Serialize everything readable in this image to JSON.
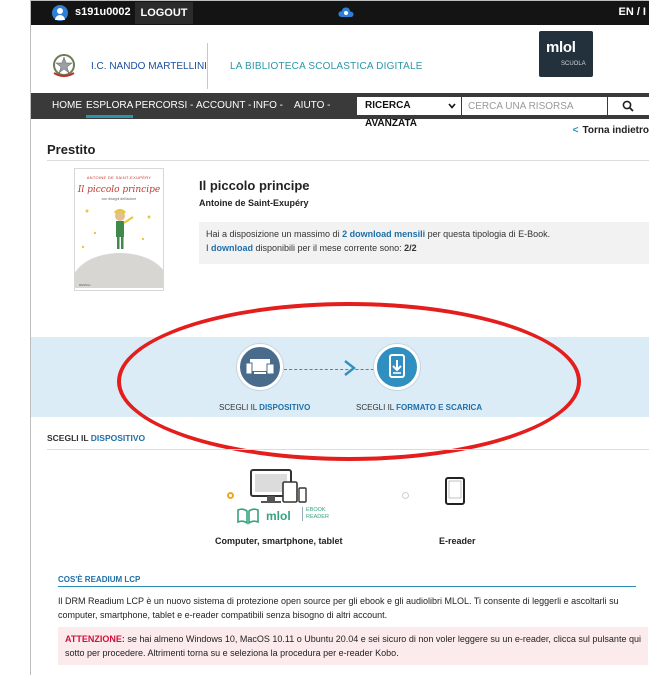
{
  "topbar": {
    "username": "s191u0002",
    "logout_label": "LOGOUT",
    "lang_label": "EN / I"
  },
  "header": {
    "school_name": "I.C. NANDO MARTELLINI",
    "library_title": "LA BIBLIOTECA SCOLASTICA DIGITALE",
    "mlol_logo_text": "mlol",
    "mlol_logo_sub": "SCUOLA"
  },
  "nav": {
    "items": [
      "HOME",
      "ESPLORA",
      "PERCORSI -",
      "ACCOUNT -",
      "INFO -",
      "AIUTO -"
    ],
    "active_item": "ESPLORA",
    "advanced_search_label": "RICERCA AVANZATA",
    "search_placeholder": "CERCA UNA RISORSA",
    "accent_color": "#2a97a8"
  },
  "back_link": "Torna indietro",
  "page_title": "Prestito",
  "book": {
    "cover_author": "ANTOINE DE SAINT-EXUPÉRY",
    "cover_title": "Il piccolo principe",
    "cover_subtitle": "con disegni dell'autore",
    "cover_publisher": "RIZZOLI",
    "title": "Il piccolo principe",
    "author": "Antoine de Saint-Exupéry"
  },
  "download_info": {
    "line1_pre": "Hai a disposizione un massimo di ",
    "line1_hl": "2 download mensili",
    "line1_post": " per questa tipologia di E-Book.",
    "line2_pre": "I ",
    "line2_hl": "download",
    "line2_mid": " disponibili per il mese corrente sono: ",
    "line2_count": "2/2"
  },
  "steps": [
    {
      "pre": "SCEGLI IL ",
      "bold": "DISPOSITIVO",
      "icon": "device-icon"
    },
    {
      "pre": "SCEGLI IL ",
      "bold": "FORMATO E SCARICA",
      "icon": "download-icon"
    }
  ],
  "device_section": {
    "heading_pre": "SCEGLI IL ",
    "heading_bold": "DISPOSITIVO",
    "options": [
      {
        "label": "Computer, smartphone, tablet",
        "selected": true,
        "icon": "computer-devices-icon",
        "brand": "mlol",
        "brand_sub": "EBOOK READER"
      },
      {
        "label": "E-reader",
        "selected": false,
        "icon": "ereader-icon"
      }
    ]
  },
  "readium": {
    "heading": "COS'È READIUM LCP",
    "text": "Il DRM Readium LCP è un nuovo sistema di protezione open source per gli ebook e gli audiolibri MLOL. Ti consente di leggerli e ascoltarli su computer, smartphone, tablet e e-reader compatibili senza bisogno di altri account."
  },
  "warning": {
    "label": "ATTENZIONE:",
    "text": " se hai almeno Windows 10, MacOS 10.11 o Ubuntu 20.04 e sei sicuro di non voler leggere su un e-reader, clicca sul pulsante qui sotto per procedere. Altrimenti torna su e seleziona la procedura per e-reader Kobo."
  },
  "colors": {
    "topbar": "#141414",
    "nav": "#3a3a3a",
    "steps_band": "#dbecf6",
    "link_blue": "#1f6fa8",
    "annotation_red": "#e41d1d",
    "warning_bg": "#fcebec",
    "warning_label": "#d0103a"
  }
}
